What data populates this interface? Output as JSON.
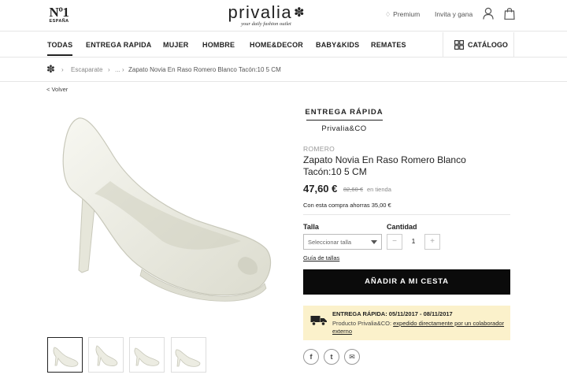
{
  "header": {
    "badge_number": "Nº1",
    "badge_country": "ESPAÑA",
    "logo_text": "privalia",
    "logo_tagline": "your daily fashion outlet",
    "premium_label": "Premium",
    "invite_label": "Invita y gana",
    "icons": [
      "diamond-icon",
      "user-icon",
      "shopping-bag-icon"
    ]
  },
  "nav": {
    "items": [
      "TODAS",
      "ENTREGA RAPIDA",
      "MUJER",
      "HOMBRE",
      "HOME&DECOR",
      "BABY&KIDS",
      "REMATES"
    ],
    "active": "TODAS",
    "catalog_label": "CATÁLOGO"
  },
  "breadcrumb": {
    "items": [
      "Escaparate",
      "...",
      "Zapato Novia En Raso Romero Blanco Tacón:10 5 CM"
    ]
  },
  "back_label": "< Volver",
  "product": {
    "delivery_title": "ENTREGA RÁPIDA",
    "delivery_sub": "Privalia&CO",
    "brand": "ROMERO",
    "title": "Zapato Novia En Raso Romero Blanco Tacón:10 5 CM",
    "price": "47,60 €",
    "old_price": "82,60 €",
    "old_price_note": "en tienda",
    "savings": "Con esta compra ahorras 35,00 €",
    "size_label": "Talla",
    "size_placeholder": "Seleccionar talla",
    "qty_label": "Cantidad",
    "qty_minus": "−",
    "qty_value": "1",
    "qty_plus": "+",
    "size_guide": "Guía de tallas",
    "add_to_cart": "AÑADIR A MI CESTA"
  },
  "delivery_box": {
    "title": "ENTREGA RÁPIDA: 05/11/2017 - 08/11/2017",
    "text_prefix": "Producto Privalia&CO: ",
    "text_link": "expedido directamente por un colaborador externo"
  },
  "social": {
    "facebook": "f",
    "twitter": "t",
    "email": "✉"
  },
  "colors": {
    "button": "#0b0b0b",
    "delivery_box_bg": "#fbf1cb",
    "shoe": "#eeeee4"
  }
}
